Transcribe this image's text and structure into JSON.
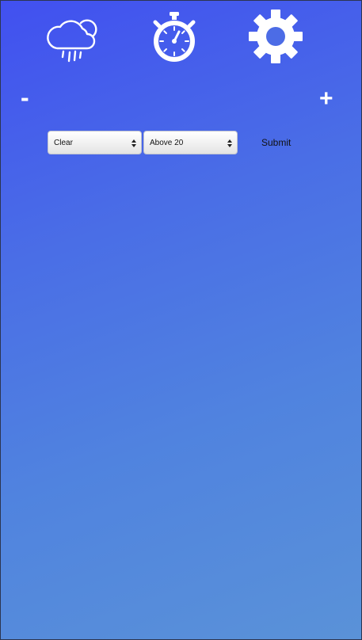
{
  "toolbar": {
    "icons": [
      "cloud-rain-icon",
      "stopwatch-icon",
      "gear-icon"
    ]
  },
  "stepper": {
    "decrement_label": "-",
    "increment_label": "+"
  },
  "form": {
    "weather_select": {
      "selected": "Clear"
    },
    "temperature_select": {
      "selected": "Above 20"
    },
    "submit_label": "Submit"
  },
  "colors": {
    "background_start": "#4150f0",
    "background_end": "#5a92d8",
    "icon": "#ffffff"
  }
}
